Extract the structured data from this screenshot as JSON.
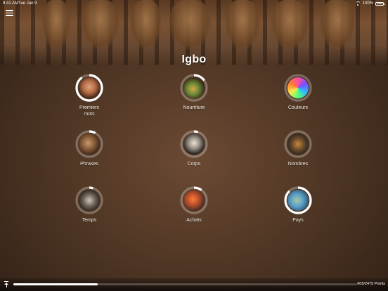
{
  "status_bar": {
    "time": "9:41 AM",
    "date": "Tue Jan 9",
    "battery": "100%",
    "icons": [
      "wifi-icon",
      "battery-icon"
    ]
  },
  "header": {
    "menu_icon": "hamburger-menu-icon",
    "title": "Igbo"
  },
  "categories": [
    {
      "label": "Premiers mots",
      "progress": 0.9,
      "icon": "faces-photo"
    },
    {
      "label": "Nourriture",
      "progress": 0.15,
      "icon": "food-photo"
    },
    {
      "label": "Couleurs",
      "progress": 0.0,
      "icon": "colors-photo"
    },
    {
      "label": "Phrases",
      "progress": 0.08,
      "icon": "phrases-photo"
    },
    {
      "label": "Corps",
      "progress": 0.05,
      "icon": "skeleton-photo"
    },
    {
      "label": "Nombres",
      "progress": 0.0,
      "icon": "numbers-photo"
    },
    {
      "label": "Temps",
      "progress": 0.05,
      "icon": "clock-photo"
    },
    {
      "label": "Achats",
      "progress": 0.1,
      "icon": "shopping-photo"
    },
    {
      "label": "Pays",
      "progress": 0.88,
      "icon": "map-photo"
    }
  ],
  "footer": {
    "icon": "upload-icon",
    "points_text": "605/2475 Points",
    "progress": 0.2444
  },
  "colors": {
    "ring_fill": "#ffffff",
    "ring_track": "rgba(255,255,255,0.28)",
    "background": "#4b3322"
  }
}
